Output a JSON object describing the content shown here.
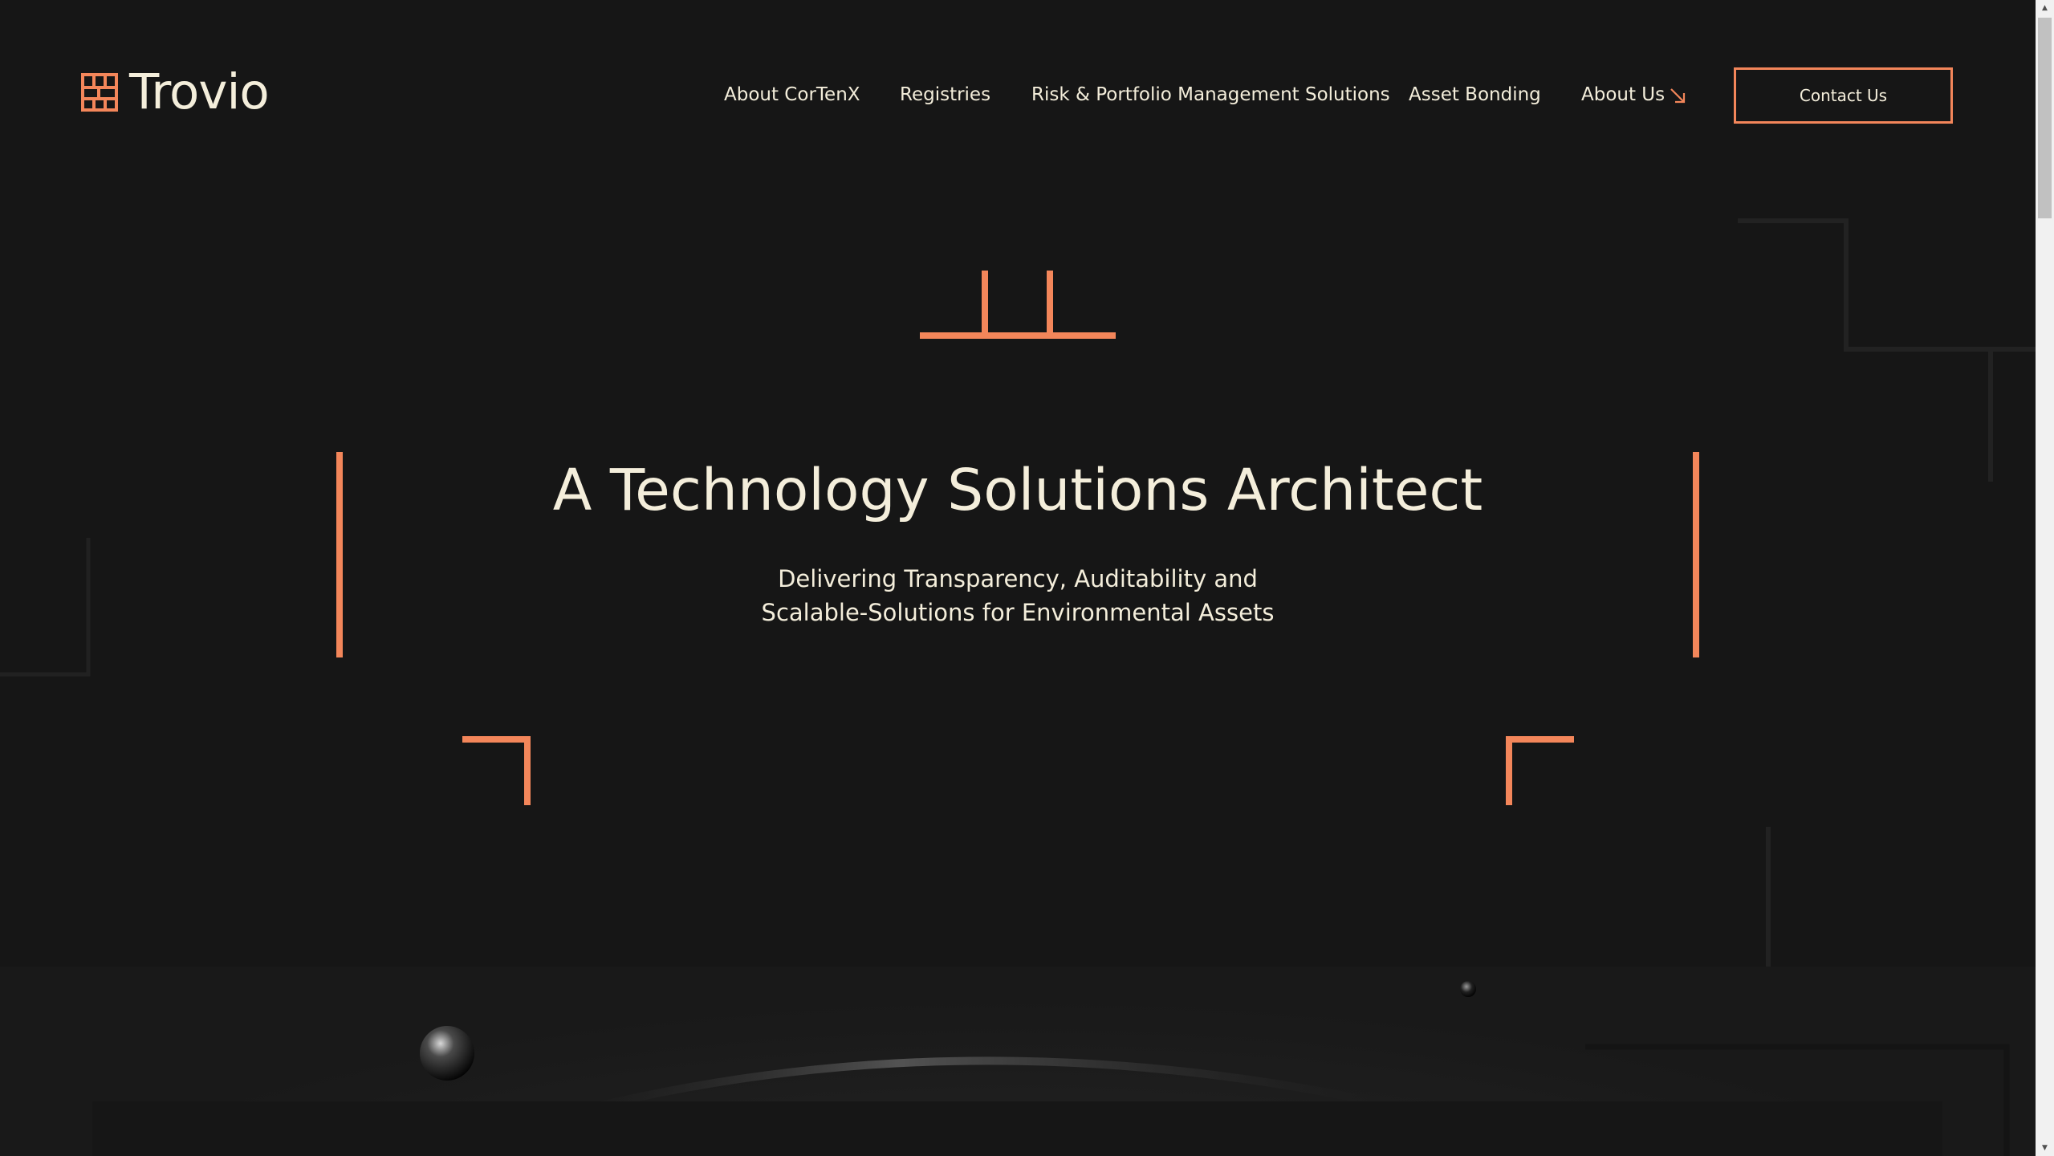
{
  "brand": {
    "name": "Trovio",
    "accent_color": "#f3865a",
    "text_color": "#f4eedb",
    "background_color": "#161616",
    "logo_icon": "grid-logo-icon"
  },
  "nav": {
    "items": [
      {
        "label": "About CorTenX"
      },
      {
        "label": "Registries"
      },
      {
        "label": "Risk & Portfolio Management Solutions"
      },
      {
        "label": "Asset Bonding"
      },
      {
        "label": "About Us",
        "icon": "arrow-down-right-icon"
      }
    ],
    "contact_label": "Contact Us"
  },
  "hero": {
    "title": "A Technology Solutions Architect",
    "subtitle_line1": "Delivering Transparency, Auditability and",
    "subtitle_line2": "Scalable-Solutions for Environmental Assets"
  },
  "scrollbar": {
    "up_icon": "scroll-up-icon",
    "down_icon": "scroll-down-icon"
  }
}
